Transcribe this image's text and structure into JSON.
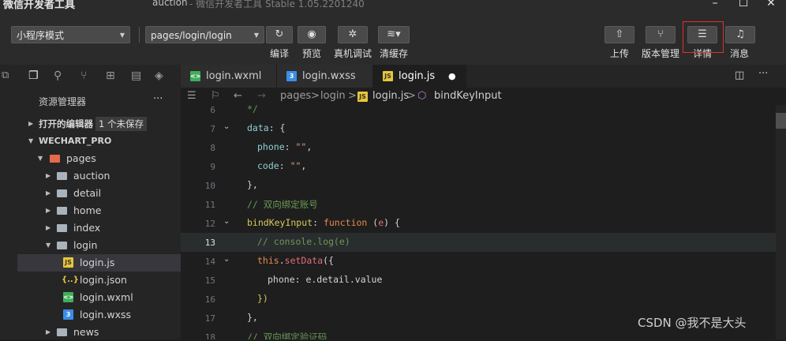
{
  "titlebar": {
    "app_title": "微信开发者工具",
    "project": "auction",
    "version": " - 微信开发者工具 Stable 1.05.2201240",
    "min": "–",
    "max": "☐",
    "close": "✕"
  },
  "toolbar": {
    "mode_select": "小程序模式",
    "page_select": "pages/login/login",
    "compile": "编译",
    "preview": "预览",
    "real_debug": "真机调试",
    "clear_cache": "清缓存",
    "upload": "上传",
    "version_mgmt": "版本管理",
    "details": "详情",
    "messages": "消息"
  },
  "sidebar": {
    "title": "资源管理器",
    "more": "···",
    "open_editors": "打开的编辑器",
    "unsaved_badge": "1 个未保存",
    "project_root": "WECHART_PRO",
    "tree": [
      {
        "label": "pages"
      },
      {
        "label": "auction"
      },
      {
        "label": "detail"
      },
      {
        "label": "home"
      },
      {
        "label": "index"
      },
      {
        "label": "login"
      },
      {
        "label": "login.js"
      },
      {
        "label": "login.json"
      },
      {
        "label": "login.wxml"
      },
      {
        "label": "login.wxss"
      },
      {
        "label": "news"
      }
    ]
  },
  "tabs": [
    {
      "label": "login.wxml"
    },
    {
      "label": "login.wxss"
    },
    {
      "label": "login.js",
      "modified": "●"
    }
  ],
  "breadcrumb": {
    "pages": "pages",
    "sep": ">",
    "login": "login",
    "file": "login.js",
    "symbol": "bindKeyInput"
  },
  "editor": {
    "line_numbers": [
      "6",
      "7",
      "8",
      "9",
      "10",
      "11",
      "12",
      "13",
      "14",
      "15",
      "16",
      "17",
      "18"
    ],
    "current_line": "13"
  },
  "watermark": "CSDN @我不是大头",
  "colors": {
    "highlight_box": "#e03030",
    "keyword": "#e68a4b",
    "property": "#8fcfd4",
    "string": "#d69d85",
    "comment": "#6a9955"
  }
}
